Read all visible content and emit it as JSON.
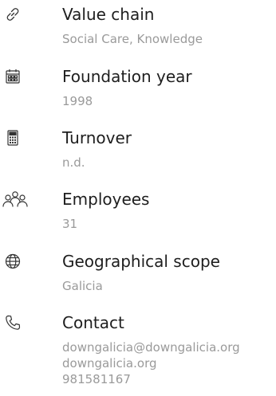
{
  "items": [
    {
      "icon": "link-icon",
      "label": "Value chain",
      "value": "Social Care, Knowledge"
    },
    {
      "icon": "calendar-icon",
      "label": "Foundation year",
      "value": "1998"
    },
    {
      "icon": "calculator-icon",
      "label": "Turnover",
      "value": "n.d."
    },
    {
      "icon": "people-icon",
      "label": "Employees",
      "value": "31"
    },
    {
      "icon": "globe-icon",
      "label": "Geographical scope",
      "value": "Galicia"
    },
    {
      "icon": "phone-icon",
      "label": "Contact",
      "values": [
        "downgalicia@downgalicia.org",
        "downgalicia.org",
        "981581167"
      ]
    }
  ]
}
